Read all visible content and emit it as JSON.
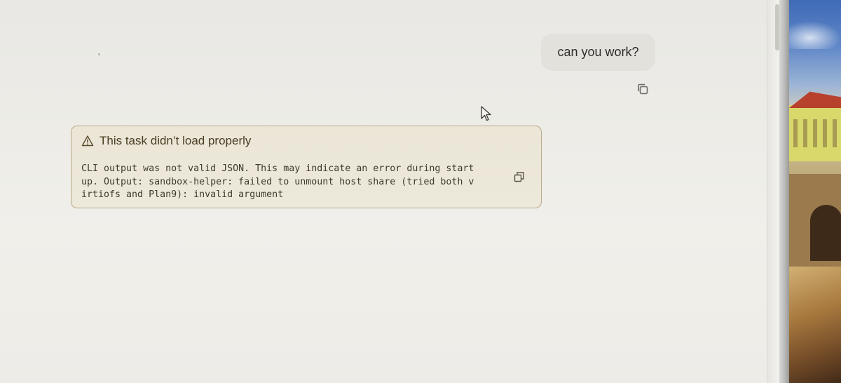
{
  "conversation": {
    "user_message": {
      "text": "can you work?",
      "copy_icon": "copy-icon"
    },
    "error": {
      "icon": "warning-triangle-icon",
      "title": "This task didn’t load properly",
      "message_lines": [
        "CLI output was not valid JSON. This may indicate an error during start",
        "up. Output: sandbox-helper: failed to unmount host share (tried both v",
        "irtiofs and Plan9): invalid argument"
      ],
      "copy_icon": "copy-icon",
      "accent_color": "#b9a98a",
      "background_color": "#ece8da"
    }
  },
  "cursor_icon": "mouse-pointer-icon"
}
